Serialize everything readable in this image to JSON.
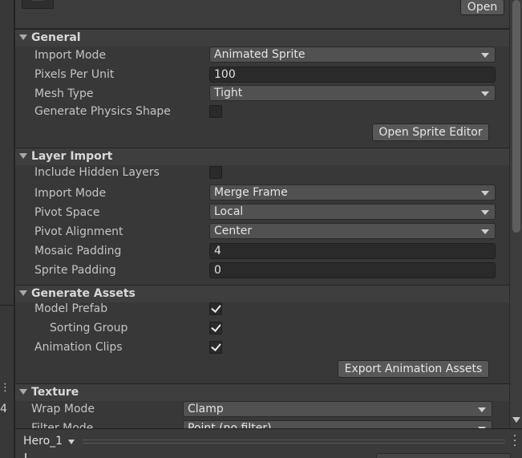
{
  "header": {
    "open_button": "Open"
  },
  "sections": {
    "general": {
      "title": "General",
      "import_mode_label": "Import Mode",
      "import_mode_value": "Animated Sprite",
      "pixels_per_unit_label": "Pixels Per Unit",
      "pixels_per_unit_value": "100",
      "mesh_type_label": "Mesh Type",
      "mesh_type_value": "Tight",
      "generate_physics_label": "Generate Physics Shape",
      "generate_physics_checked": false,
      "open_sprite_editor": "Open Sprite Editor"
    },
    "layer_import": {
      "title": "Layer Import",
      "include_hidden_label": "Include Hidden Layers",
      "include_hidden_checked": false,
      "import_mode_label": "Import Mode",
      "import_mode_value": "Merge Frame",
      "pivot_space_label": "Pivot Space",
      "pivot_space_value": "Local",
      "pivot_alignment_label": "Pivot Alignment",
      "pivot_alignment_value": "Center",
      "mosaic_padding_label": "Mosaic Padding",
      "mosaic_padding_value": "4",
      "sprite_padding_label": "Sprite Padding",
      "sprite_padding_value": "0"
    },
    "generate_assets": {
      "title": "Generate Assets",
      "model_prefab_label": "Model Prefab",
      "model_prefab_checked": true,
      "sorting_group_label": "Sorting Group",
      "sorting_group_checked": true,
      "animation_clips_label": "Animation Clips",
      "animation_clips_checked": true,
      "export_button": "Export Animation Assets"
    },
    "texture": {
      "title": "Texture",
      "wrap_mode_label": "Wrap Mode",
      "wrap_mode_value": "Clamp",
      "filter_mode_label": "Filter Mode",
      "filter_mode_value": "Point (no filter)"
    }
  },
  "left_panel": {
    "partial_1": "⋮",
    "partial_2": "4"
  },
  "bottom_bar": {
    "preview_name": "Hero_1"
  },
  "colors": {
    "background": "#383838",
    "header": "#3e3e3e",
    "dropdown": "#515151",
    "textfield": "#2a2a2a",
    "button": "#585858"
  }
}
